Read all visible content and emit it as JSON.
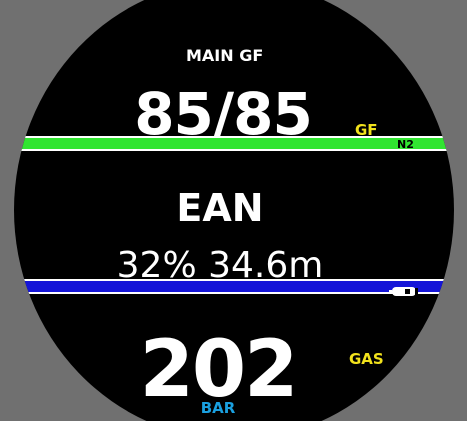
{
  "gradient_factor": {
    "label": "MAIN GF",
    "value": "85/85",
    "unit": "GF"
  },
  "nitrogen": {
    "tag": "N2",
    "bar_color": "#31e531"
  },
  "gas": {
    "name": "EAN",
    "detail": "32% 34.6m"
  },
  "tank": {
    "bar_color": "#1515d8",
    "icon": "tank-icon",
    "pressure": "202",
    "tag": "GAS",
    "unit": "BAR"
  },
  "colors": {
    "accent_yellow": "#f2e21c",
    "unit_blue": "#1aa0e0"
  }
}
